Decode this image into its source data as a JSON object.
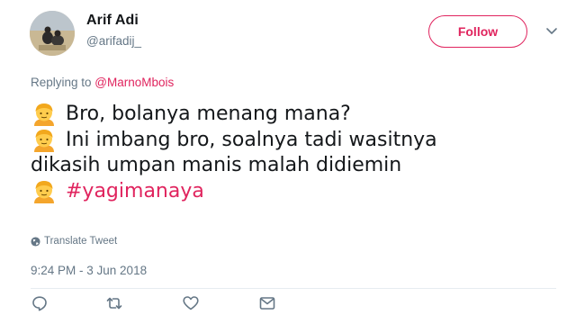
{
  "author": {
    "display_name": "Arif Adi",
    "username": "@arifadij_",
    "avatar_icon": "avatar-photo"
  },
  "follow_button": {
    "label": "Follow",
    "accent": "#e0245e"
  },
  "reply": {
    "prefix": "Replying to ",
    "mention": "@MarnoMbois"
  },
  "tweet": {
    "lines": [
      {
        "emoji": "person-emoji",
        "text": "Bro, bolanya menang mana?"
      },
      {
        "emoji": "person-emoji",
        "text": "Ini imbang bro, soalnya tadi wasitnya"
      },
      {
        "emoji": null,
        "text": "dikasih umpan manis malah didiemin"
      },
      {
        "emoji": "person-emoji",
        "text": "#yagimanaya"
      }
    ]
  },
  "translate": {
    "label": "Translate Tweet",
    "icon": "globe-icon"
  },
  "timestamp": "9:24 PM - 3 Jun 2018",
  "actions": [
    {
      "name": "reply-icon"
    },
    {
      "name": "retweet-icon"
    },
    {
      "name": "like-icon"
    },
    {
      "name": "direct-message-icon"
    }
  ],
  "colors": {
    "text": "#14171a",
    "muted": "#657786",
    "link": "#e0245e",
    "divider": "#e6ecf0"
  }
}
